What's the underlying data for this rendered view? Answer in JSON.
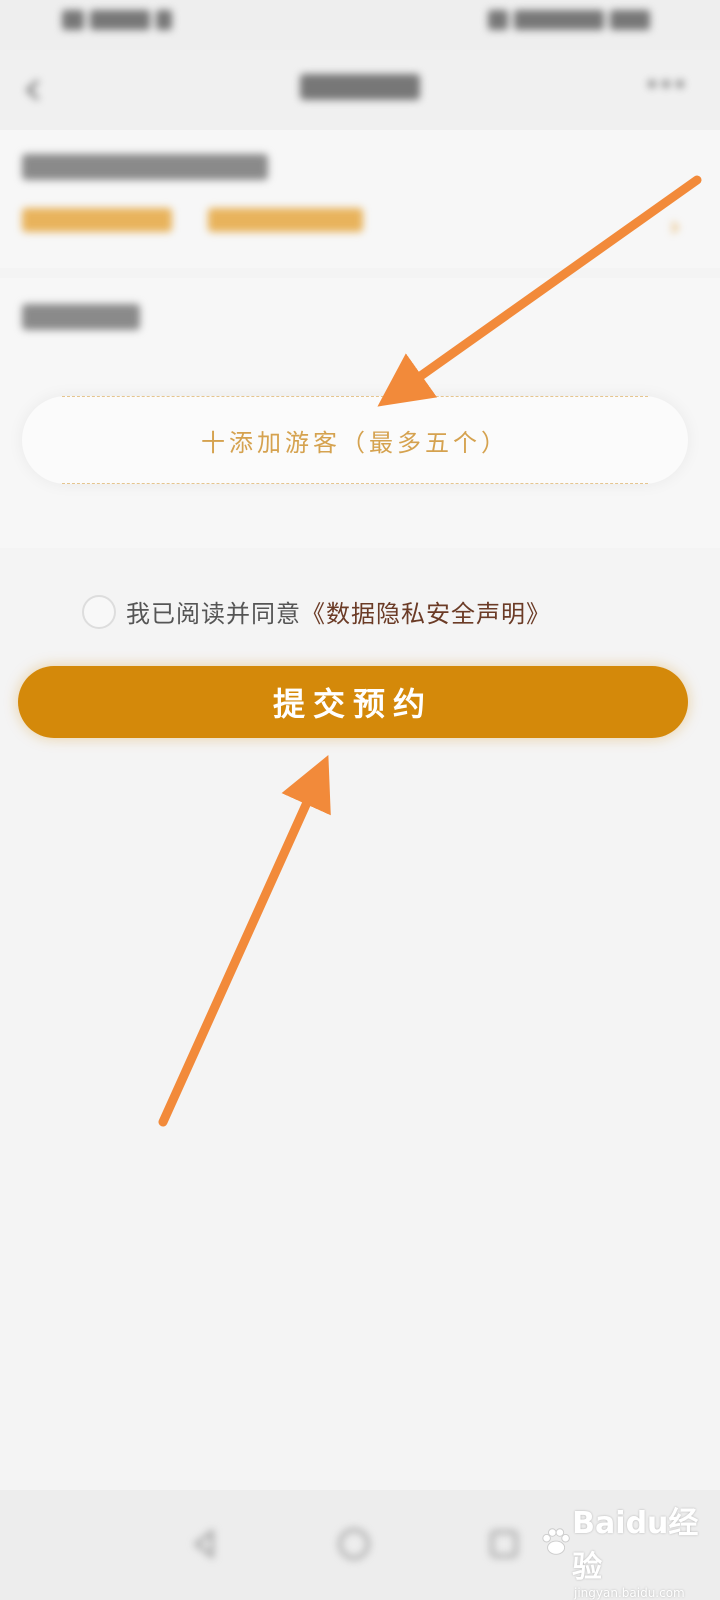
{
  "add_visitor_label": "十添加游客（最多五个）",
  "agreement": {
    "prefix": "我已阅读并同意",
    "link": "《数据隐私安全声明》"
  },
  "submit_label": "提交预约",
  "watermark": {
    "logo_text": "Baidu经验",
    "url": "jingyan.baidu.com"
  },
  "colors": {
    "accent": "#d4890a",
    "add_visitor_text": "#d5a24f",
    "link_text": "#6b3b26",
    "annotation_arrow": "#f28a3a"
  },
  "icons": [
    "back-icon",
    "more-icon",
    "chevron-right-icon",
    "checkbox-icon",
    "annotation-arrow-icon",
    "baidu-paw-icon"
  ]
}
